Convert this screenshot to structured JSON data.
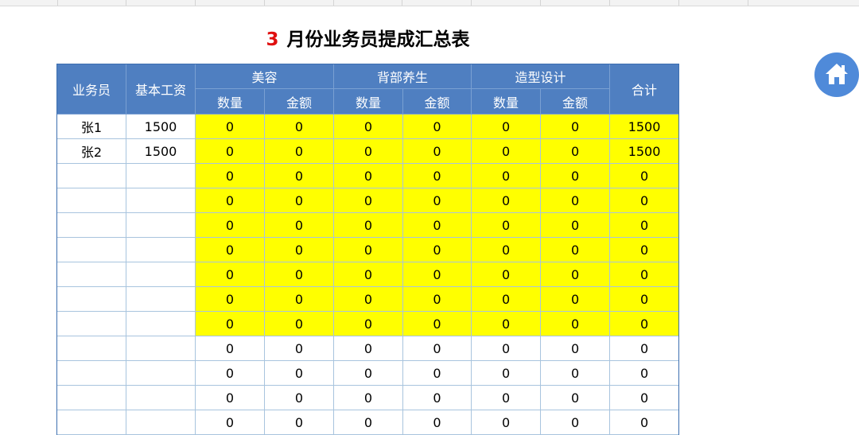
{
  "title": {
    "month": "3",
    "text": "月份业务员提成汇总表"
  },
  "header": {
    "salesperson": "业务员",
    "base_salary": "基本工资",
    "groups": [
      "美容",
      "背部养生",
      "造型设计"
    ],
    "quantity": "数量",
    "amount": "金额",
    "total": "合计"
  },
  "rows": [
    {
      "name": "张1",
      "salary": "1500",
      "values": [
        "0",
        "0",
        "0",
        "0",
        "0",
        "0"
      ],
      "total": "1500",
      "highlight": true
    },
    {
      "name": "张2",
      "salary": "1500",
      "values": [
        "0",
        "0",
        "0",
        "0",
        "0",
        "0"
      ],
      "total": "1500",
      "highlight": true
    },
    {
      "name": "",
      "salary": "",
      "values": [
        "0",
        "0",
        "0",
        "0",
        "0",
        "0"
      ],
      "total": "0",
      "highlight": true
    },
    {
      "name": "",
      "salary": "",
      "values": [
        "0",
        "0",
        "0",
        "0",
        "0",
        "0"
      ],
      "total": "0",
      "highlight": true
    },
    {
      "name": "",
      "salary": "",
      "values": [
        "0",
        "0",
        "0",
        "0",
        "0",
        "0"
      ],
      "total": "0",
      "highlight": true
    },
    {
      "name": "",
      "salary": "",
      "values": [
        "0",
        "0",
        "0",
        "0",
        "0",
        "0"
      ],
      "total": "0",
      "highlight": true
    },
    {
      "name": "",
      "salary": "",
      "values": [
        "0",
        "0",
        "0",
        "0",
        "0",
        "0"
      ],
      "total": "0",
      "highlight": true
    },
    {
      "name": "",
      "salary": "",
      "values": [
        "0",
        "0",
        "0",
        "0",
        "0",
        "0"
      ],
      "total": "0",
      "highlight": true
    },
    {
      "name": "",
      "salary": "",
      "values": [
        "0",
        "0",
        "0",
        "0",
        "0",
        "0"
      ],
      "total": "0",
      "highlight": true
    },
    {
      "name": "",
      "salary": "",
      "values": [
        "0",
        "0",
        "0",
        "0",
        "0",
        "0"
      ],
      "total": "0",
      "highlight": false
    },
    {
      "name": "",
      "salary": "",
      "values": [
        "0",
        "0",
        "0",
        "0",
        "0",
        "0"
      ],
      "total": "0",
      "highlight": false
    },
    {
      "name": "",
      "salary": "",
      "values": [
        "0",
        "0",
        "0",
        "0",
        "0",
        "0"
      ],
      "total": "0",
      "highlight": false
    },
    {
      "name": "",
      "salary": "",
      "values": [
        "0",
        "0",
        "0",
        "0",
        "0",
        "0"
      ],
      "total": "0",
      "highlight": false
    }
  ],
  "colors": {
    "header_bg": "#4f7fc1",
    "highlight": "#ffff00",
    "title_number": "#e01010",
    "home_button": "#4f8ad9"
  },
  "icons": {
    "home": "home-icon"
  }
}
